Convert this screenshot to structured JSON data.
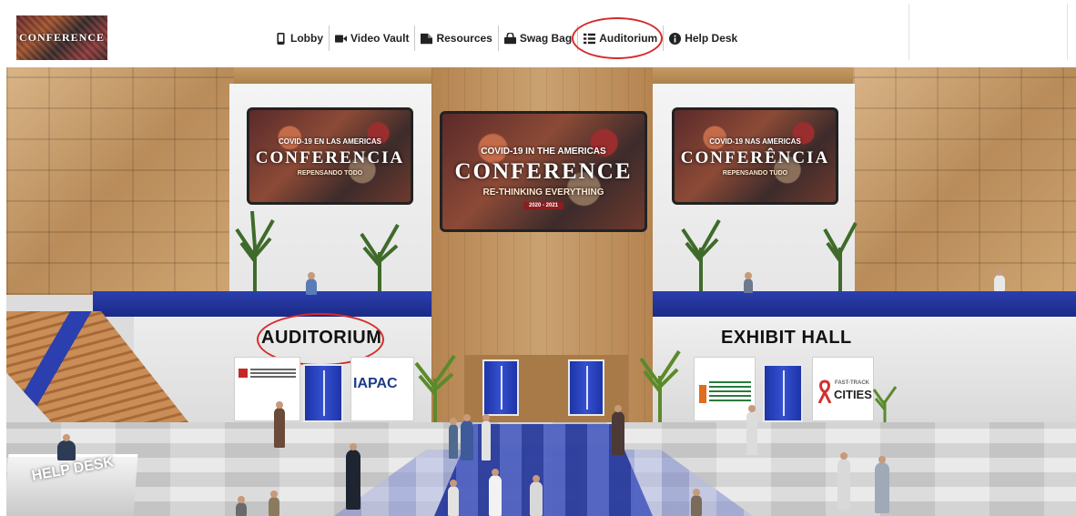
{
  "topbar": {
    "logo_text": "CONFERENCE",
    "nav": [
      {
        "id": "lobby",
        "label": "Lobby",
        "icon": "mobile-device-icon"
      },
      {
        "id": "video-vault",
        "label": "Video Vault",
        "icon": "video-camera-icon"
      },
      {
        "id": "resources",
        "label": "Resources",
        "icon": "file-folder-icon"
      },
      {
        "id": "swag-bag",
        "label": "Swag Bag",
        "icon": "shopping-bag-icon"
      },
      {
        "id": "auditorium",
        "label": "Auditorium",
        "icon": "list-icon"
      },
      {
        "id": "help-desk",
        "label": "Help Desk",
        "icon": "info-circle-icon"
      }
    ]
  },
  "scene": {
    "screens": {
      "left": {
        "top": "COVID-19 EN LAS AMERICAS",
        "big": "CONFERENCIA",
        "sub": "REPENSANDO TODO"
      },
      "center": {
        "top": "COVID-19 IN THE AMERICAS",
        "big": "CONFERENCE",
        "sub": "RE-THINKING EVERYTHING",
        "date": "2020 - 2021"
      },
      "right": {
        "top": "COVID-19 NAS AMERICAS",
        "big": "CONFERÊNCIA",
        "sub": "REPENSANDO TUDO"
      }
    },
    "signs": {
      "auditorium": "AUDITORIUM",
      "exhibit_hall": "EXHIBIT HALL"
    },
    "banners": {
      "iapac": "IAPAC",
      "cities_top": "FAST-TRACK",
      "cities": "CITIES"
    },
    "help_desk": "HELP DESK"
  },
  "colors": {
    "annotation": "#d62b2b",
    "accent_blue": "#2b3fae"
  }
}
